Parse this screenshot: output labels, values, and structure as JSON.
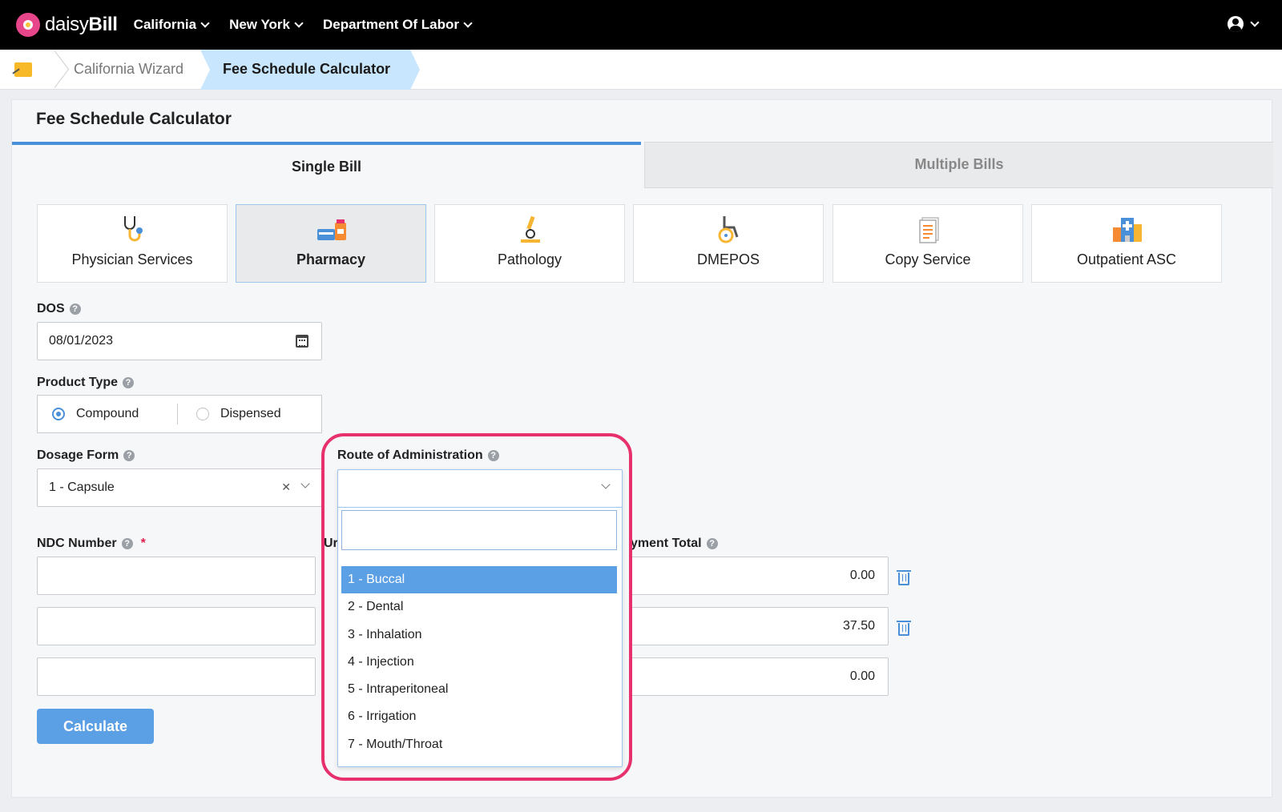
{
  "nav": {
    "brand_light": "daisy",
    "brand_bold": "Bill",
    "items": [
      "California",
      "New York",
      "Department Of Labor"
    ]
  },
  "breadcrumb": {
    "items": [
      "California Wizard",
      "Fee Schedule Calculator"
    ]
  },
  "page": {
    "title": "Fee Schedule Calculator",
    "tabs": [
      "Single Bill",
      "Multiple Bills"
    ]
  },
  "tiles": [
    {
      "label": "Physician Services",
      "icon": "stethoscope-icon"
    },
    {
      "label": "Pharmacy",
      "icon": "pharmacy-icon"
    },
    {
      "label": "Pathology",
      "icon": "microscope-icon"
    },
    {
      "label": "DMEPOS",
      "icon": "wheelchair-icon"
    },
    {
      "label": "Copy Service",
      "icon": "document-icon"
    },
    {
      "label": "Outpatient ASC",
      "icon": "hospital-icon"
    }
  ],
  "form": {
    "dos_label": "DOS",
    "dos_value": "08/01/2023",
    "product_type_label": "Product Type",
    "product_types": [
      "Compound",
      "Dispensed"
    ],
    "dosage_form_label": "Dosage Form",
    "dosage_form_value": "1 - Capsule",
    "route_label": "Route of Administration",
    "ndc_label": "NDC Number",
    "units_label_partial": "Ur",
    "payment_total_label_partial": "yment Total",
    "payment_totals": [
      "0.00",
      "37.50",
      "0.00"
    ],
    "calculate_label": "Calculate"
  },
  "route_options": [
    "1 - Buccal",
    "2 - Dental",
    "3 - Inhalation",
    "4 - Injection",
    "5 - Intraperitoneal",
    "6 - Irrigation",
    "7 - Mouth/Throat"
  ],
  "colors": {
    "accent": "#5b9fe4",
    "highlight": "#e6316d",
    "breadcrumb_active": "#c9e6ff"
  }
}
